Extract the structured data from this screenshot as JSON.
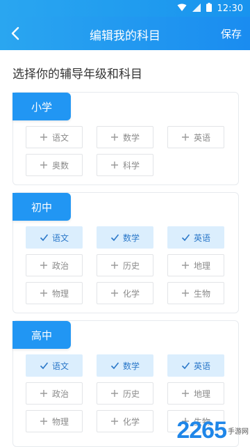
{
  "status_bar": {
    "time": "12:30"
  },
  "nav": {
    "title": "编辑我的科目",
    "save_label": "保存"
  },
  "heading": "选择你的辅导年级和科目",
  "sections": [
    {
      "title": "小学",
      "subjects": [
        {
          "label": "语文",
          "selected": false
        },
        {
          "label": "数学",
          "selected": false
        },
        {
          "label": "英语",
          "selected": false
        },
        {
          "label": "奥数",
          "selected": false
        },
        {
          "label": "科学",
          "selected": false
        }
      ]
    },
    {
      "title": "初中",
      "subjects": [
        {
          "label": "语文",
          "selected": true
        },
        {
          "label": "数学",
          "selected": true
        },
        {
          "label": "英语",
          "selected": true
        },
        {
          "label": "政治",
          "selected": false
        },
        {
          "label": "历史",
          "selected": false
        },
        {
          "label": "地理",
          "selected": false
        },
        {
          "label": "物理",
          "selected": false
        },
        {
          "label": "化学",
          "selected": false
        },
        {
          "label": "生物",
          "selected": false
        }
      ]
    },
    {
      "title": "高中",
      "subjects": [
        {
          "label": "语文",
          "selected": true
        },
        {
          "label": "数学",
          "selected": true
        },
        {
          "label": "英语",
          "selected": true
        },
        {
          "label": "政治",
          "selected": false
        },
        {
          "label": "历史",
          "selected": false
        },
        {
          "label": "地理",
          "selected": false
        },
        {
          "label": "物理",
          "selected": false
        },
        {
          "label": "化学",
          "selected": false
        },
        {
          "label": "生物",
          "selected": false
        }
      ]
    }
  ],
  "watermark": {
    "number": "2265",
    "text": "手游网"
  },
  "colors": {
    "accent": "#2196f3",
    "selected_bg": "#dbeefd",
    "selected_text": "#2b78c9",
    "unselected_text": "#8a8a8a",
    "border": "#e2e4e7"
  }
}
